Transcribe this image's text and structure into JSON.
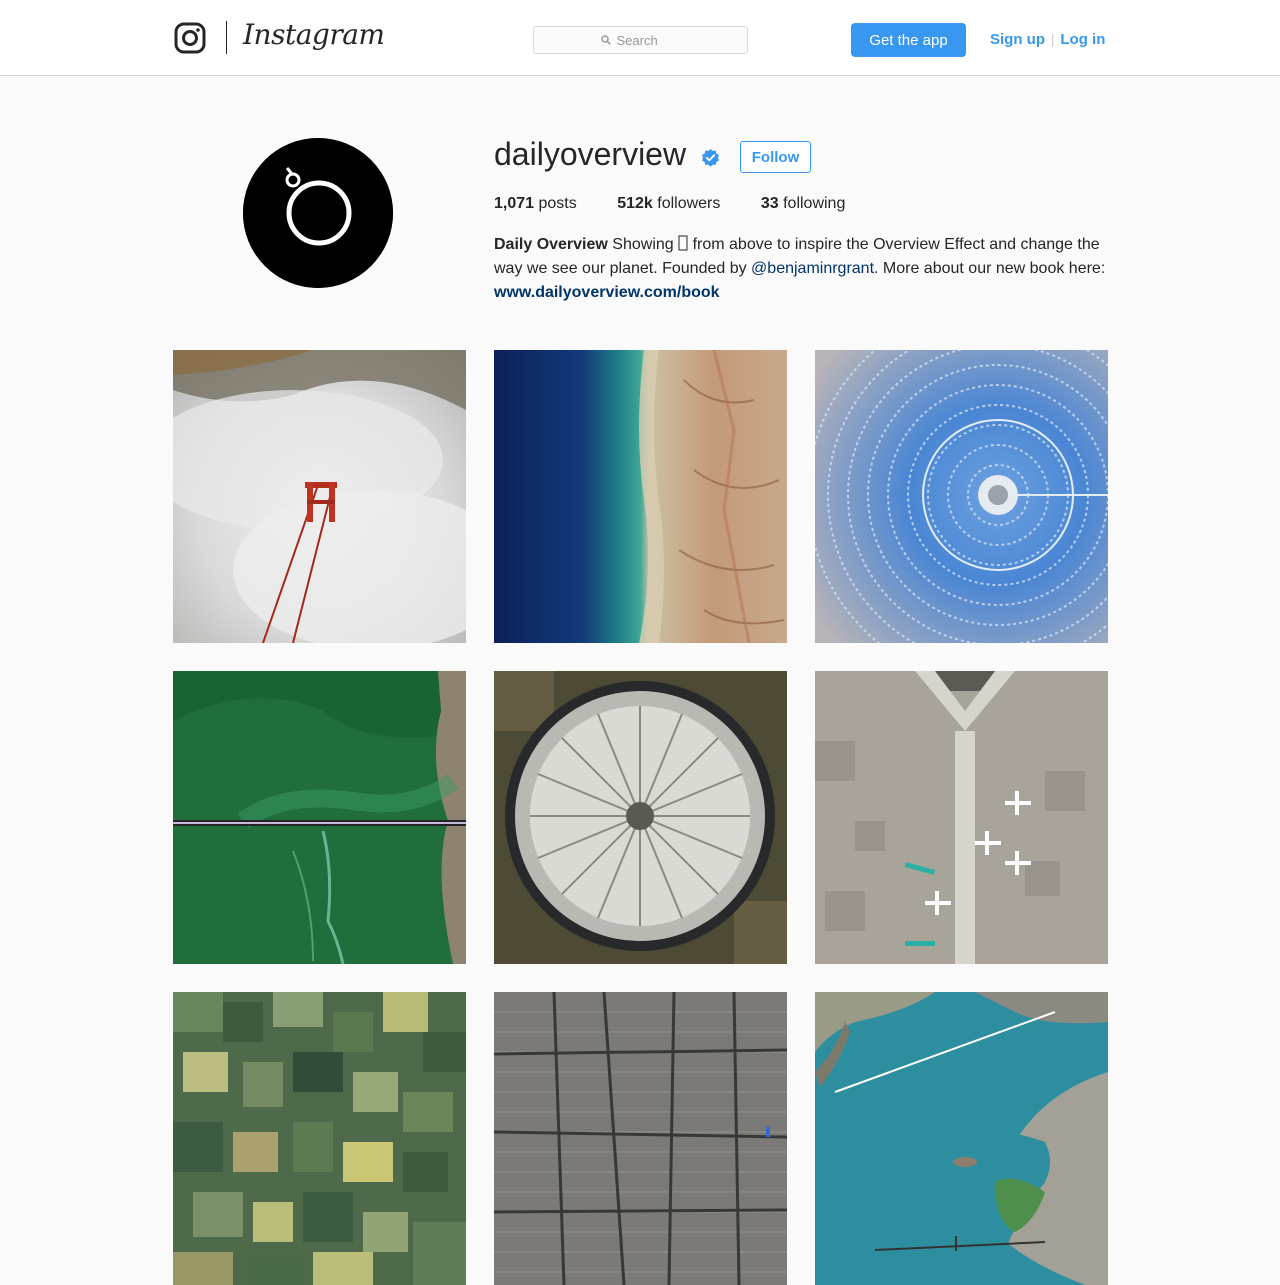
{
  "header": {
    "brand": "Instagram",
    "search_placeholder": "Search",
    "get_app_label": "Get the app",
    "signup_label": "Sign up",
    "login_label": "Log in"
  },
  "profile": {
    "username": "dailyoverview",
    "follow_label": "Follow",
    "stats": {
      "posts_count": "1,071",
      "posts_label": "posts",
      "followers_count": "512k",
      "followers_label": "followers",
      "following_count": "33",
      "following_label": "following"
    },
    "bio": {
      "name": "Daily Overview",
      "text1": "Showing ",
      "text2": " from above to inspire the Overview Effect and change the way we see our planet. Founded by ",
      "mention": "@benjaminrgrant",
      "text3": ". More about our new book here: ",
      "link": "www.dailyoverview.com/book"
    }
  },
  "colors": {
    "accent": "#3897f0",
    "link_dark": "#003569",
    "text": "#262626",
    "background": "#fafafa"
  },
  "icons": {
    "logo": "instagram-camera-icon",
    "search": "search-icon",
    "verified": "verified-badge-icon",
    "emoji_placeholder": "missing-glyph-icon"
  }
}
